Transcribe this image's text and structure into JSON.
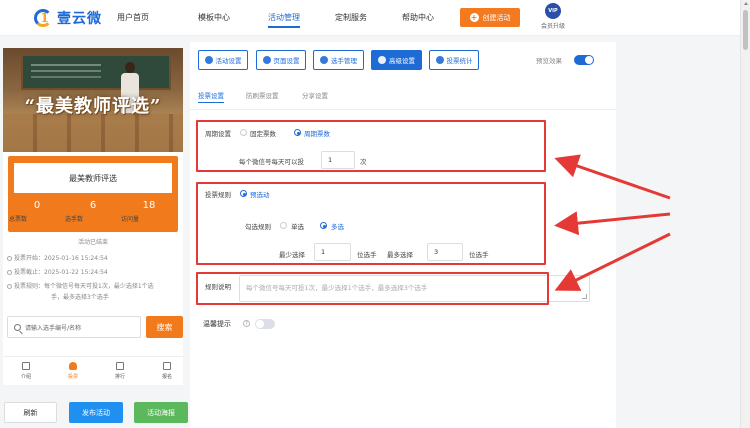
{
  "brand": {
    "name": "壹云微",
    "sub": "1YUN"
  },
  "nav": {
    "items": [
      {
        "label": "用户首页",
        "active": false
      },
      {
        "label": "模板中心",
        "active": false
      },
      {
        "label": "活动管理",
        "active": true
      },
      {
        "label": "定制服务",
        "active": false
      },
      {
        "label": "帮助中心",
        "active": false
      }
    ],
    "create_label": "创建活动",
    "vip_badge": "VIP",
    "vip_label": "会员升级"
  },
  "preview": {
    "banner_title": "“最美教师评选”",
    "card_title": "最美教师评选",
    "stats": [
      {
        "num": "0",
        "label": "总票数"
      },
      {
        "num": "6",
        "label": "选手数"
      },
      {
        "num": "18",
        "label": "访问量"
      }
    ],
    "status": "活动已结束",
    "start": "投票开始：2025-01-16 15:24:54",
    "end": "投票截止：2025-01-22 15:24:54",
    "rule_line1": "投票规则：每个微信号每天可投1次，最少选择1个选",
    "rule_line2": "手，最多选择3个选手",
    "search_placeholder": "请输入选手编号/名称",
    "search_button": "搜索",
    "tabs": [
      {
        "label": "介绍",
        "active": false
      },
      {
        "label": "投票",
        "active": true
      },
      {
        "label": "排行",
        "active": false
      },
      {
        "label": "报名",
        "active": false
      }
    ]
  },
  "bottom_buttons": {
    "refresh": "刷新",
    "publish": "发布活动",
    "poster": "活动海报"
  },
  "toolbar": {
    "buttons": [
      {
        "label": "活动设置",
        "icon": "gear-icon",
        "active": false
      },
      {
        "label": "页面设置",
        "icon": "palette-icon",
        "active": false
      },
      {
        "label": "选手管理",
        "icon": "users-icon",
        "active": false
      },
      {
        "label": "高级设置",
        "icon": "sliders-icon",
        "active": true
      },
      {
        "label": "投票统计",
        "icon": "bar-chart-icon",
        "active": false
      }
    ],
    "preview_label": "预览效果",
    "preview_on": true
  },
  "subtabs": [
    {
      "label": "投票设置",
      "active": true
    },
    {
      "label": "防刷票设置",
      "active": false
    },
    {
      "label": "分享设置",
      "active": false
    }
  ],
  "form": {
    "cycle": {
      "label": "周期设置",
      "opt_fixed": "固定票数",
      "opt_period": "周期票数",
      "selected": "周期票数",
      "per_day_label": "每个微信号每天可以投",
      "per_day_value": "1",
      "unit": "次"
    },
    "rule": {
      "label": "投票规则",
      "preset": "预选动",
      "check_rule_label": "勾选规则",
      "opt_single": "单选",
      "opt_multi": "多选",
      "selected": "多选",
      "min_label": "最少选择",
      "min_value": "1",
      "min_unit": "位选手",
      "max_label": "最多选择",
      "max_value": "3",
      "max_unit": "位选手"
    },
    "desc": {
      "label": "规则说明",
      "placeholder": "每个微信号每天可投1次，最少选择1个选手，最多选择3个选手"
    },
    "tip": {
      "label": "温馨提示",
      "on": false
    }
  },
  "colors": {
    "primary": "#1e6bd6",
    "orange": "#f07a1c",
    "highlight": "#e53935",
    "green": "#5cb85c"
  }
}
